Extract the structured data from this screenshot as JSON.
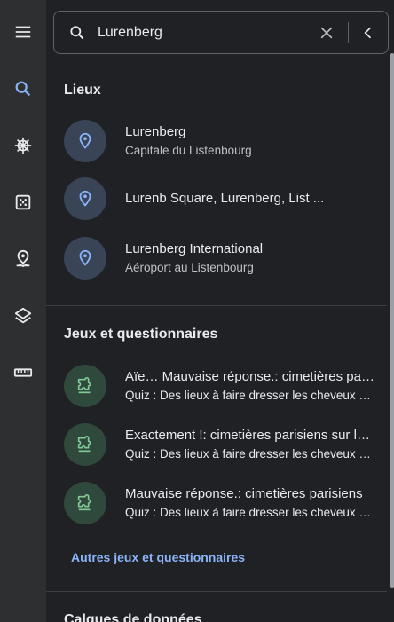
{
  "search": {
    "value": "Lurenberg",
    "placeholder": ""
  },
  "rail": {
    "items": [
      {
        "icon": "menu-icon"
      },
      {
        "icon": "search-icon",
        "active": true
      },
      {
        "icon": "ship-wheel-icon"
      },
      {
        "icon": "dice-icon"
      },
      {
        "icon": "pin-user-icon"
      },
      {
        "icon": "layers-icon"
      },
      {
        "icon": "ruler-icon"
      }
    ]
  },
  "places": {
    "title": "Lieux",
    "items": [
      {
        "title": "Lurenberg",
        "subtitle": "Capitale du Listenbourg"
      },
      {
        "title": "Lurenb Square, Lurenberg, List ...",
        "subtitle": ""
      },
      {
        "title": "Lurenberg International",
        "subtitle": "Aéroport au Listenbourg"
      }
    ]
  },
  "quizzes": {
    "title": "Jeux et questionnaires",
    "items": [
      {
        "title": "Aïe… Mauvaise réponse.: cimetières parisiens",
        "subtitle": "Quiz : Des lieux à faire dresser les cheveux sur la tête"
      },
      {
        "title": "Exactement !: cimetières parisiens sur la carte",
        "subtitle": "Quiz : Des lieux à faire dresser les cheveux sur la tête"
      },
      {
        "title": "Mauvaise réponse.: cimetières parisiens",
        "subtitle": "Quiz : Des lieux à faire dresser les cheveux sur la tête"
      }
    ],
    "more_label": "Autres jeux et questionnaires"
  },
  "data_layers": {
    "title": "Calques de données"
  },
  "colors": {
    "accent": "#8ab4f8",
    "place_circle": "#394457",
    "quiz_circle": "#2f4a3c",
    "quiz_icon": "#81c995"
  }
}
